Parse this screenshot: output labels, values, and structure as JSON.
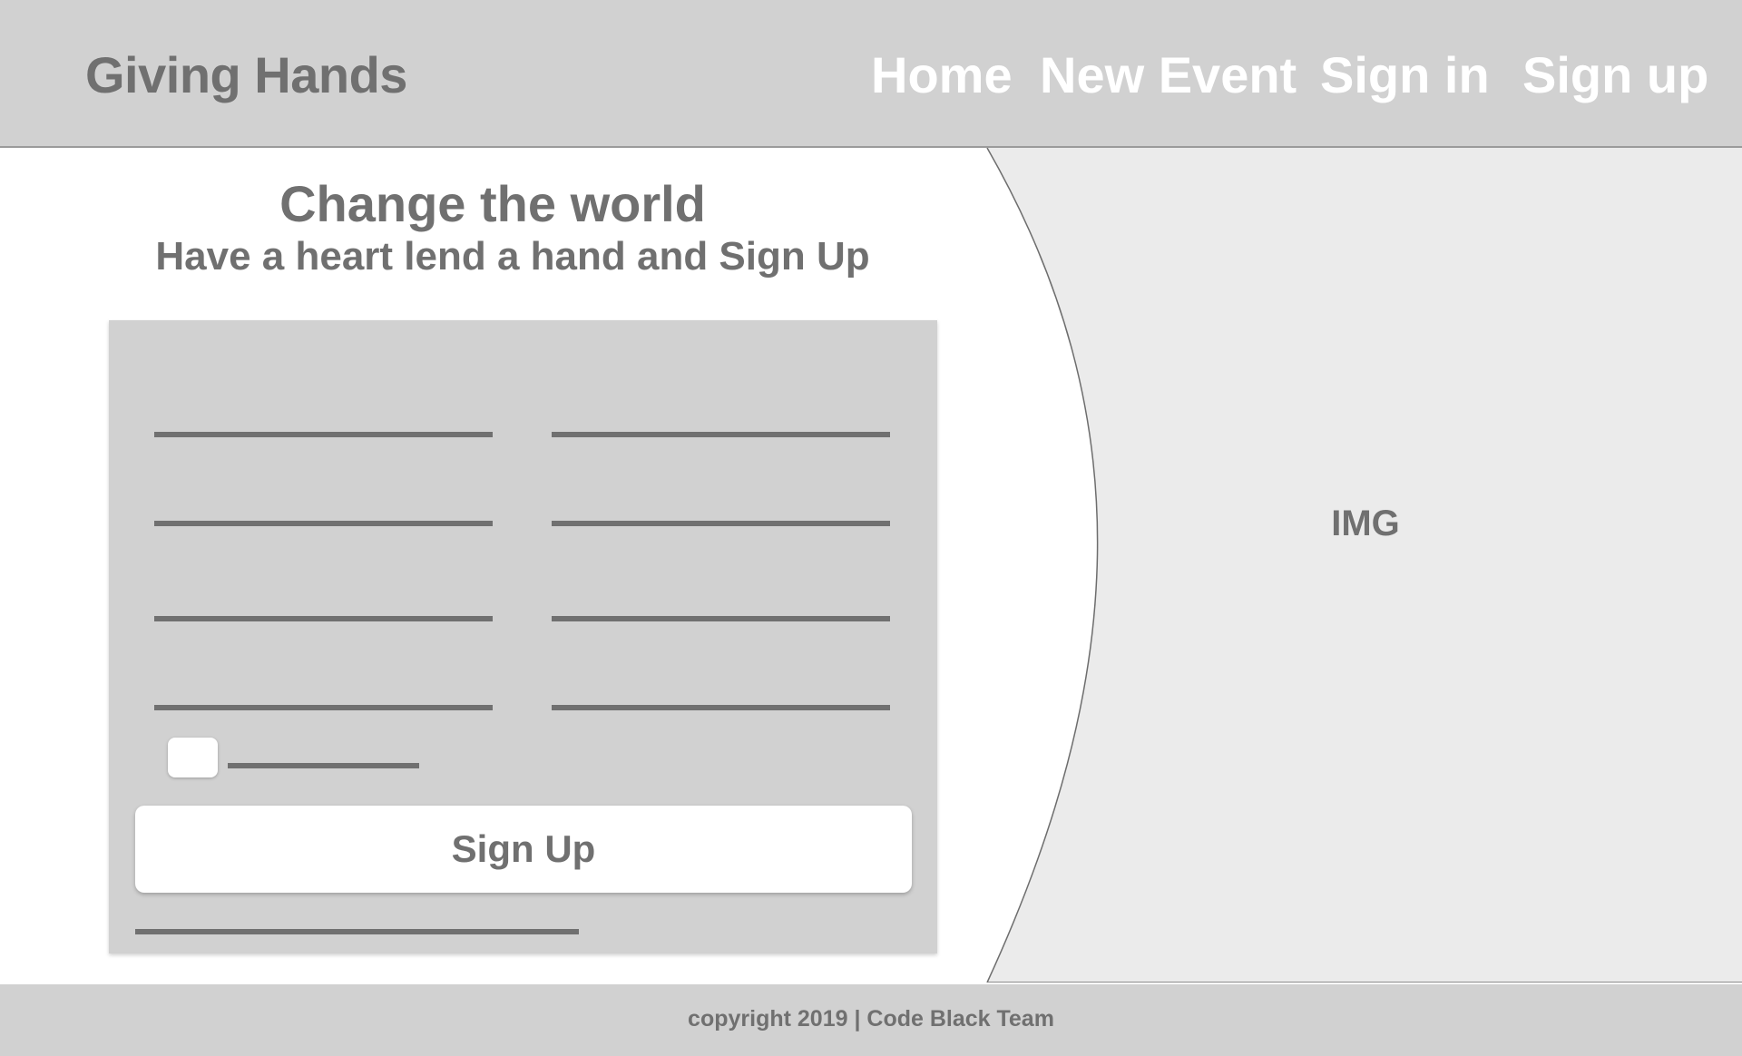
{
  "header": {
    "brand": "Giving Hands",
    "nav": {
      "home": "Home",
      "new_event": "New Event",
      "sign_in": "Sign in",
      "sign_up": "Sign up"
    }
  },
  "hero": {
    "title": "Change the world",
    "subtitle": "Have a heart lend a hand and Sign Up"
  },
  "image_placeholder": {
    "label": "IMG"
  },
  "form": {
    "submit_label": "Sign Up"
  },
  "footer": {
    "copyright": "copyright 2019 | Code Black Team"
  },
  "colors": {
    "header_bg": "#d1d1d1",
    "text_gray": "#707070",
    "image_bg": "#ebebeb",
    "card_bg": "#d1d1d1",
    "button_bg": "#ffffff",
    "nav_text": "#ffffff"
  }
}
